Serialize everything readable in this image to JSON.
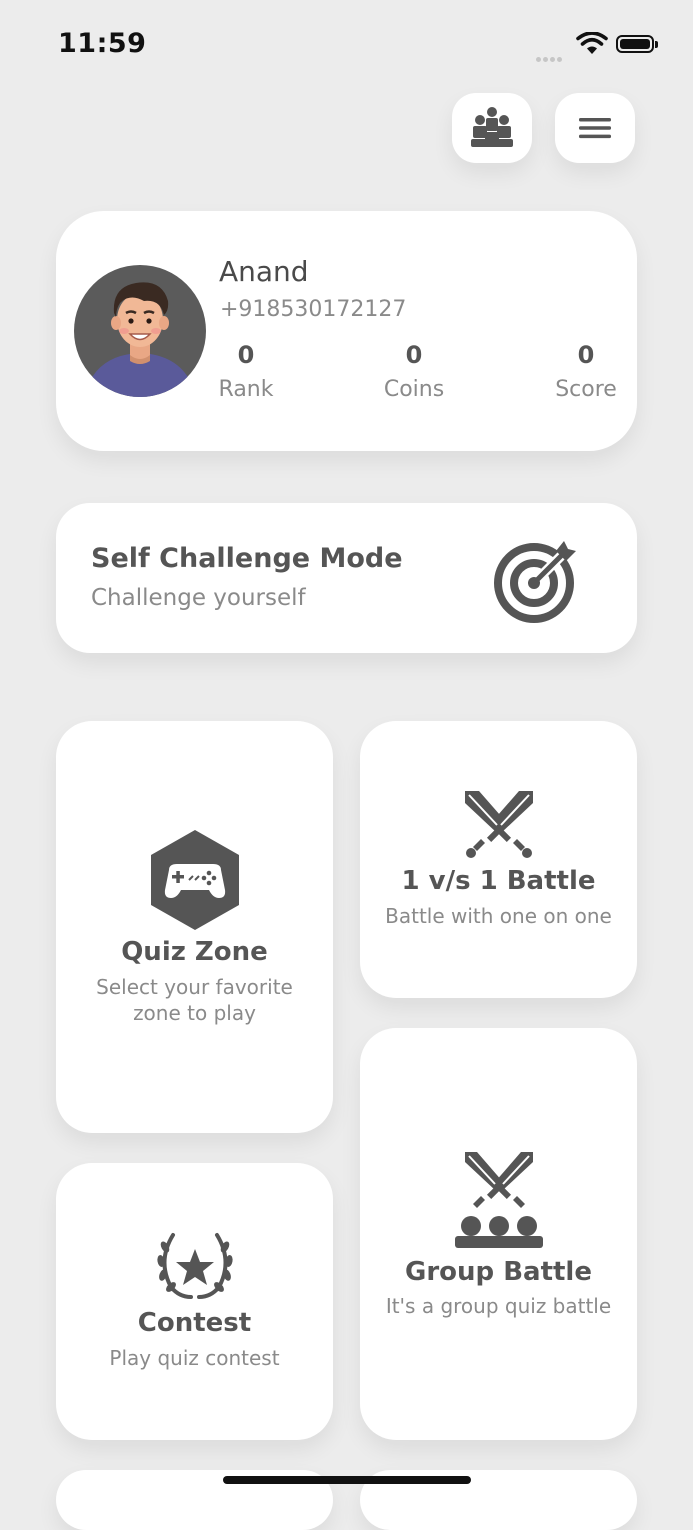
{
  "status_bar": {
    "time": "11:59"
  },
  "header": {
    "leaderboard_icon": "group-people-icon",
    "menu_icon": "hamburger-menu-icon"
  },
  "profile": {
    "name": "Anand",
    "phone": "+918530172127",
    "stats": [
      {
        "value": "0",
        "label": "Rank"
      },
      {
        "value": "0",
        "label": "Coins"
      },
      {
        "value": "0",
        "label": "Score"
      }
    ]
  },
  "self_challenge": {
    "title": "Self Challenge Mode",
    "subtitle": "Challenge yourself",
    "icon": "target-icon"
  },
  "tiles": {
    "quiz_zone": {
      "title": "Quiz Zone",
      "subtitle_line1": "Select your favorite",
      "subtitle_line2": "zone to play",
      "icon": "gamepad-icon"
    },
    "battle": {
      "title": "1 v/s 1 Battle",
      "subtitle": "Battle with one on one",
      "icon": "crossed-swords-icon"
    },
    "contest": {
      "title": "Contest",
      "subtitle": "Play quiz contest",
      "icon": "laurel-star-icon"
    },
    "group_battle": {
      "title": "Group Battle",
      "subtitle": "It's a group quiz battle",
      "icon": "group-battle-icon"
    }
  },
  "colors": {
    "background": "#ececec",
    "card": "#ffffff",
    "icon": "#555555",
    "text_muted": "#8a8a8a"
  }
}
